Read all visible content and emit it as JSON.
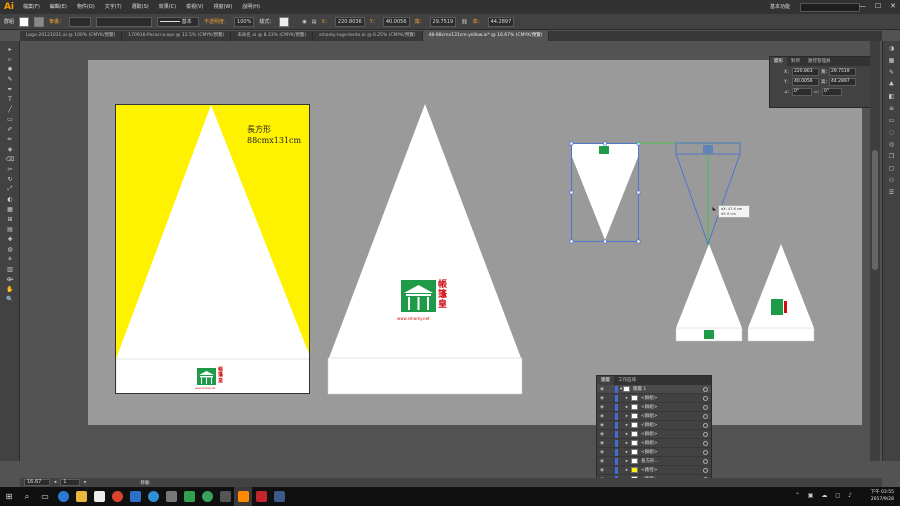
{
  "app": {
    "logo": "Ai",
    "workspace": "基本功能",
    "window_buttons": [
      "—",
      "☐",
      "✕"
    ]
  },
  "menu": [
    "檔案(F)",
    "編輯(E)",
    "物件(O)",
    "文字(T)",
    "選取(S)",
    "效果(C)",
    "檢視(V)",
    "視窗(W)",
    "說明(H)"
  ],
  "control_bar": {
    "selection": "群組",
    "stroke_label": "筆畫：",
    "stroke_style": "基本",
    "opacity_label": "不透明度：",
    "opacity_value": "100%",
    "style_label": "樣式：",
    "x_label": "X：",
    "x_value": "220.8036",
    "y_label": "Y：",
    "y_value": "40.0056",
    "w_label": "寬：",
    "w_value": "29.7519",
    "h_label": "高：",
    "h_value": "44.2897"
  },
  "tabs": [
    {
      "label": "Logo-20121031.ai @ 100% (CMYK/預覽)",
      "active": false
    },
    {
      "label": "170916-Pocari-a.eps @ 12.5% (CMYK/預覽)",
      "active": false
    },
    {
      "label": "未命名 ai @ 8.33% (CMYK/預覽)",
      "active": false
    },
    {
      "label": "smarky-logo-tento.ai @ 6.25% (CMYK/預覽)",
      "active": false
    },
    {
      "label": "48-88cmx131cm-yellow.ai* @ 16.67% (CMYK/預覽)",
      "active": true
    }
  ],
  "tools": [
    "▸",
    "▹",
    "✱",
    "✎",
    "✒",
    "T",
    "╱",
    "▭",
    "✐",
    "✏",
    "◈",
    "⌫",
    "✂",
    "↻",
    "⤢",
    "◐",
    "▦",
    "⊞",
    "▤",
    "✚",
    "◍",
    "⚘",
    "▥",
    "⟴",
    "✋",
    "🔍"
  ],
  "artboard_label": {
    "line1": "長方形",
    "line2": "88cmx131cm"
  },
  "logo": {
    "chars": [
      "帳",
      "篷",
      "皇"
    ],
    "url": "www.smarky.net"
  },
  "transform_panel": {
    "tabs": [
      "變形",
      "對齊",
      "路徑管理員"
    ],
    "x_label": "X：",
    "x": "220.803",
    "w_label": "寬：",
    "w": "29.7519",
    "y_label": "Y：",
    "y": "40.0056",
    "h_label": "高：",
    "h": "44.2897",
    "angle_label": "⊿：",
    "angle": "0°",
    "shear_label": "▱：",
    "shear": "0°"
  },
  "tooltip": {
    "line1": "dX: 47.6 cm",
    "line2": "dY: 0 cm"
  },
  "layers_panel": {
    "tabs": [
      "圖層",
      "工作區域"
    ],
    "rows": [
      {
        "label": "圖層 1",
        "indent": 0,
        "selected": true,
        "thumb": "#ffffff"
      },
      {
        "label": "<群組>",
        "indent": 1,
        "thumb": "#ffffff"
      },
      {
        "label": "<群組>",
        "indent": 1,
        "thumb": "#ffffff"
      },
      {
        "label": "<群組>",
        "indent": 1,
        "thumb": "#ffffff"
      },
      {
        "label": "<群組>",
        "indent": 1,
        "thumb": "#ffffff"
      },
      {
        "label": "<群組>",
        "indent": 1,
        "thumb": "#ffffff"
      },
      {
        "label": "<群組>",
        "indent": 1,
        "thumb": "#ffffff"
      },
      {
        "label": "<群組>",
        "indent": 1,
        "thumb": "#ffffff"
      },
      {
        "label": "長方形...",
        "indent": 1,
        "thumb": "#ffffff"
      },
      {
        "label": "<路徑>",
        "indent": 1,
        "thumb": "#fff200"
      },
      {
        "label": "<路徑>",
        "indent": 1,
        "thumb": "#ffffff"
      }
    ]
  },
  "status": {
    "zoom": "16.67",
    "page": "1",
    "mode": "移動"
  },
  "clock": {
    "time": "下午 03:55",
    "date": "2017/9/28"
  },
  "colors": {
    "accent": "#fff200",
    "logo_green": "#1f9a48",
    "logo_red": "#d10d10",
    "selection": "#3f6ed8",
    "guide": "#33cc33"
  }
}
